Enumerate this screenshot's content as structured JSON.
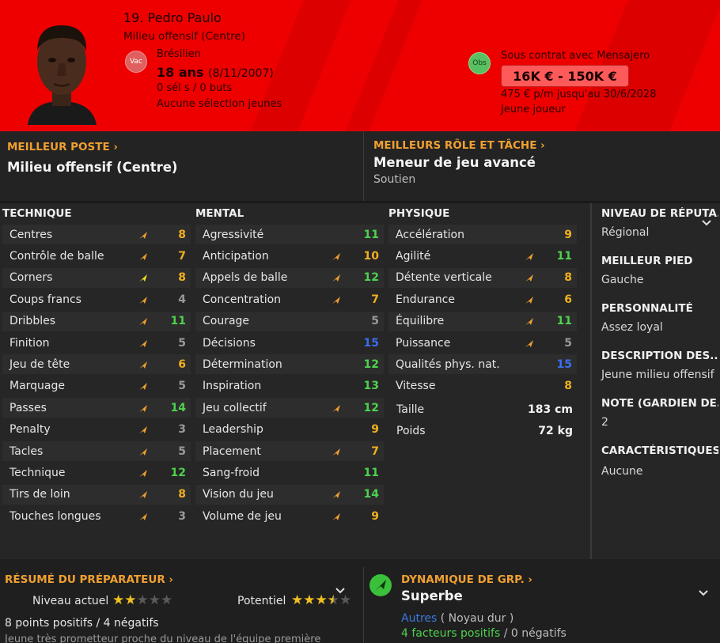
{
  "header": {
    "name": "19. Pedro Paulo",
    "position": "Milieu offensif (Centre)",
    "status_badge": "Vac",
    "nationality": "Brésilien",
    "age": "18 ans",
    "dob": "(8/11/2007)",
    "caps": "0 sél s / 0 buts",
    "youth": "Aucune sélection jeunes",
    "obs_badge": "Obs",
    "contract": "Sous contrat avec Mensajero",
    "value_range": "16K € - 150K €",
    "wage": "475 € p/m jusqu'au 30/6/2028",
    "type": "Jeune joueur"
  },
  "best_position": {
    "title": "MEILLEUR POSTE",
    "value": "Milieu offensif (Centre)"
  },
  "best_role": {
    "title": "MEILLEURS RÔLE ET TÂCHE",
    "value": "Meneur de jeu avancé",
    "duty": "Soutien"
  },
  "technique": {
    "title": "TECHNIQUE",
    "items": [
      {
        "name": "Centres",
        "value": "8",
        "color": "gold"
      },
      {
        "name": "Contrôle de balle",
        "value": "7",
        "color": "gold"
      },
      {
        "name": "Corners",
        "value": "8",
        "color": "gold"
      },
      {
        "name": "Coups francs",
        "value": "4",
        "color": "grey"
      },
      {
        "name": "Dribbles",
        "value": "11",
        "color": "green"
      },
      {
        "name": "Finition",
        "value": "5",
        "color": "grey"
      },
      {
        "name": "Jeu de tête",
        "value": "6",
        "color": "gold"
      },
      {
        "name": "Marquage",
        "value": "5",
        "color": "grey"
      },
      {
        "name": "Passes",
        "value": "14",
        "color": "green"
      },
      {
        "name": "Penalty",
        "value": "3",
        "color": "grey"
      },
      {
        "name": "Tacles",
        "value": "5",
        "color": "grey"
      },
      {
        "name": "Technique",
        "value": "12",
        "color": "green"
      },
      {
        "name": "Tirs de loin",
        "value": "8",
        "color": "gold"
      },
      {
        "name": "Touches longues",
        "value": "3",
        "color": "grey"
      }
    ]
  },
  "mental": {
    "title": "MENTAL",
    "items": [
      {
        "name": "Agressivité",
        "value": "11",
        "color": "green"
      },
      {
        "name": "Anticipation",
        "value": "10",
        "color": "gold"
      },
      {
        "name": "Appels de balle",
        "value": "12",
        "color": "green"
      },
      {
        "name": "Concentration",
        "value": "7",
        "color": "gold"
      },
      {
        "name": "Courage",
        "value": "5",
        "color": "grey"
      },
      {
        "name": "Décisions",
        "value": "15",
        "color": "blue"
      },
      {
        "name": "Détermination",
        "value": "12",
        "color": "green"
      },
      {
        "name": "Inspiration",
        "value": "13",
        "color": "green"
      },
      {
        "name": "Jeu collectif",
        "value": "12",
        "color": "green"
      },
      {
        "name": "Leadership",
        "value": "9",
        "color": "gold"
      },
      {
        "name": "Placement",
        "value": "7",
        "color": "gold"
      },
      {
        "name": "Sang-froid",
        "value": "11",
        "color": "green"
      },
      {
        "name": "Vision du jeu",
        "value": "14",
        "color": "green"
      },
      {
        "name": "Volume de jeu",
        "value": "9",
        "color": "gold"
      }
    ]
  },
  "physique": {
    "title": "PHYSIQUE",
    "items": [
      {
        "name": "Accélération",
        "value": "9",
        "color": "gold"
      },
      {
        "name": "Agilité",
        "value": "11",
        "color": "green"
      },
      {
        "name": "Détente verticale",
        "value": "8",
        "color": "gold"
      },
      {
        "name": "Endurance",
        "value": "6",
        "color": "gold"
      },
      {
        "name": "Équilibre",
        "value": "11",
        "color": "green"
      },
      {
        "name": "Puissance",
        "value": "5",
        "color": "grey"
      },
      {
        "name": "Qualités phys. nat.",
        "value": "15",
        "color": "blue"
      },
      {
        "name": "Vitesse",
        "value": "8",
        "color": "gold"
      }
    ],
    "height_label": "Taille",
    "height": "183 cm",
    "weight_label": "Poids",
    "weight": "72 kg"
  },
  "side": [
    {
      "title": "NIVEAU DE RÉPUTA...",
      "value": "Régional"
    },
    {
      "title": "MEILLEUR PIED",
      "value": "Gauche"
    },
    {
      "title": "PERSONNALITÉ",
      "value": "Assez loyal"
    },
    {
      "title": "DESCRIPTION DES...",
      "value": "Jeune milieu offensif"
    },
    {
      "title": "NOTE (GARDIEN DE...",
      "value": "2"
    },
    {
      "title": "CARACTÉRISTIQUES",
      "value": "Aucune"
    }
  ],
  "coach": {
    "title": "RÉSUMÉ DU PRÉPARATEUR",
    "current_label": "Niveau actuel",
    "current_stars": 2,
    "potential_label": "Potentiel",
    "potential_stars": 3.5,
    "points": "8 points positifs / 4 négatifs",
    "comment": "Jeune très prometteur proche du niveau de l'équipe première"
  },
  "group": {
    "title": "DYNAMIQUE DE GRP.",
    "value": "Superbe",
    "others_label": "Autres",
    "others_group": "( Noyau dur )",
    "positives": "4 facteurs positifs",
    "sep": "/",
    "negatives": "0 négatifs"
  },
  "colors": {
    "header": "#ee0000",
    "accent": "#f0a030",
    "green": "#4ed24e",
    "gold": "#f0b020",
    "blue": "#3a6ef0"
  }
}
